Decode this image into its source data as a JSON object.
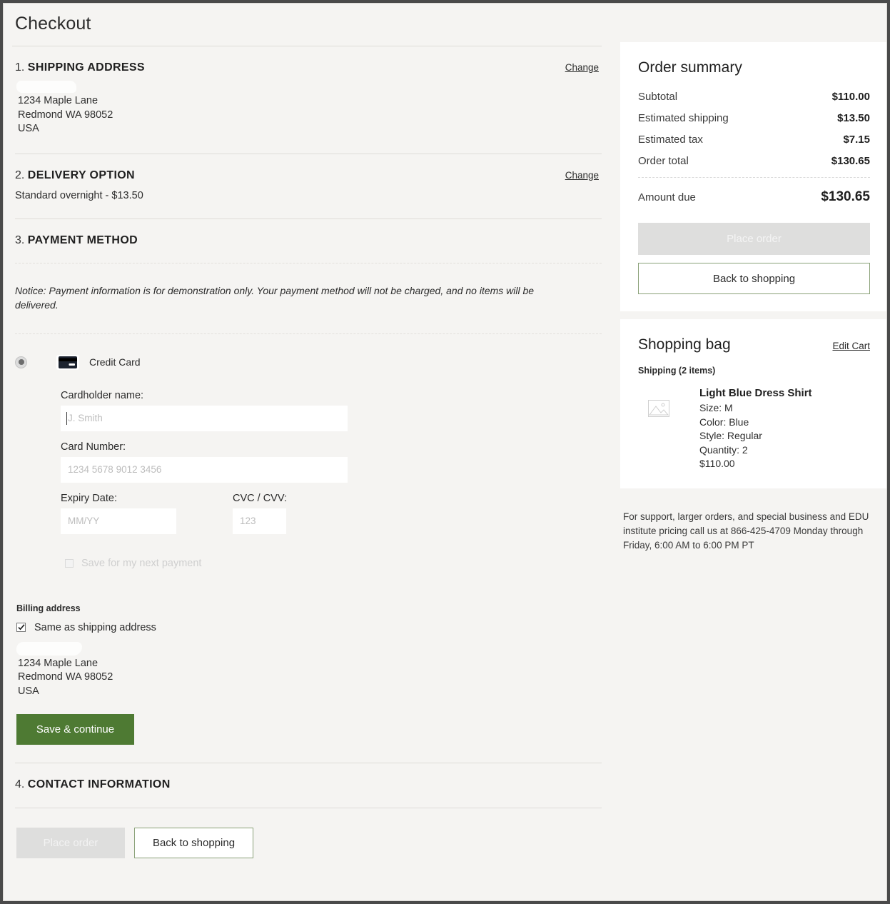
{
  "page": {
    "title": "Checkout"
  },
  "sections": {
    "shipping": {
      "number": "1.",
      "label": "SHIPPING ADDRESS",
      "change_label": "Change",
      "address": [
        "1234 Maple Lane",
        "Redmond WA 98052",
        "USA"
      ]
    },
    "delivery": {
      "number": "2.",
      "label": "DELIVERY OPTION",
      "change_label": "Change",
      "option": "Standard overnight -  $13.50"
    },
    "payment": {
      "number": "3.",
      "label": "PAYMENT METHOD",
      "notice": "Notice: Payment information is for demonstration only.  Your payment method will not be charged, and no items will be delivered.",
      "method_label": "Credit Card",
      "fields": {
        "cardholder_label": "Cardholder name:",
        "cardholder_placeholder": "J. Smith",
        "cardnumber_label": "Card Number:",
        "cardnumber_placeholder": "1234 5678 9012 3456",
        "expiry_label": "Expiry Date:",
        "expiry_placeholder": "MM/YY",
        "cvc_label": "CVC / CVV:",
        "cvc_placeholder": "123"
      },
      "save_next_label": "Save for my next payment",
      "billing_head": "Billing address",
      "same_as_shipping_label": "Same as shipping address",
      "billing_address": [
        "1234 Maple Lane",
        "Redmond WA 98052",
        "USA"
      ],
      "save_continue_label": "Save & continue"
    },
    "contact": {
      "number": "4.",
      "label": "CONTACT INFORMATION",
      "place_order_label": "Place order",
      "back_label": "Back to shopping"
    }
  },
  "order_summary": {
    "title": "Order summary",
    "rows": [
      {
        "label": "Subtotal",
        "value": "$110.00"
      },
      {
        "label": "Estimated shipping",
        "value": "$13.50"
      },
      {
        "label": "Estimated tax",
        "value": "$7.15"
      },
      {
        "label": "Order total",
        "value": "$130.65"
      }
    ],
    "amount_due_label": "Amount due",
    "amount_due_value": "$130.65",
    "place_order_label": "Place order",
    "back_label": "Back to shopping"
  },
  "shopping_bag": {
    "title": "Shopping bag",
    "edit_cart_label": "Edit Cart",
    "shipping_count": "Shipping (2 items)",
    "item": {
      "name": "Light Blue Dress Shirt",
      "size": "Size: M",
      "color": "Color: Blue",
      "style": "Style: Regular",
      "quantity": "Quantity: 2",
      "price": "$110.00"
    }
  },
  "support_text": "For support, larger orders, and special business and EDU institute pricing call us at 866-425-4709 Monday through Friday, 6:00 AM to 6:00 PM PT",
  "colors": {
    "accent_green": "#4e7a33",
    "outline_green": "#8aa178",
    "page_bg": "#f5f4f2",
    "card_bg": "#ffffff"
  }
}
